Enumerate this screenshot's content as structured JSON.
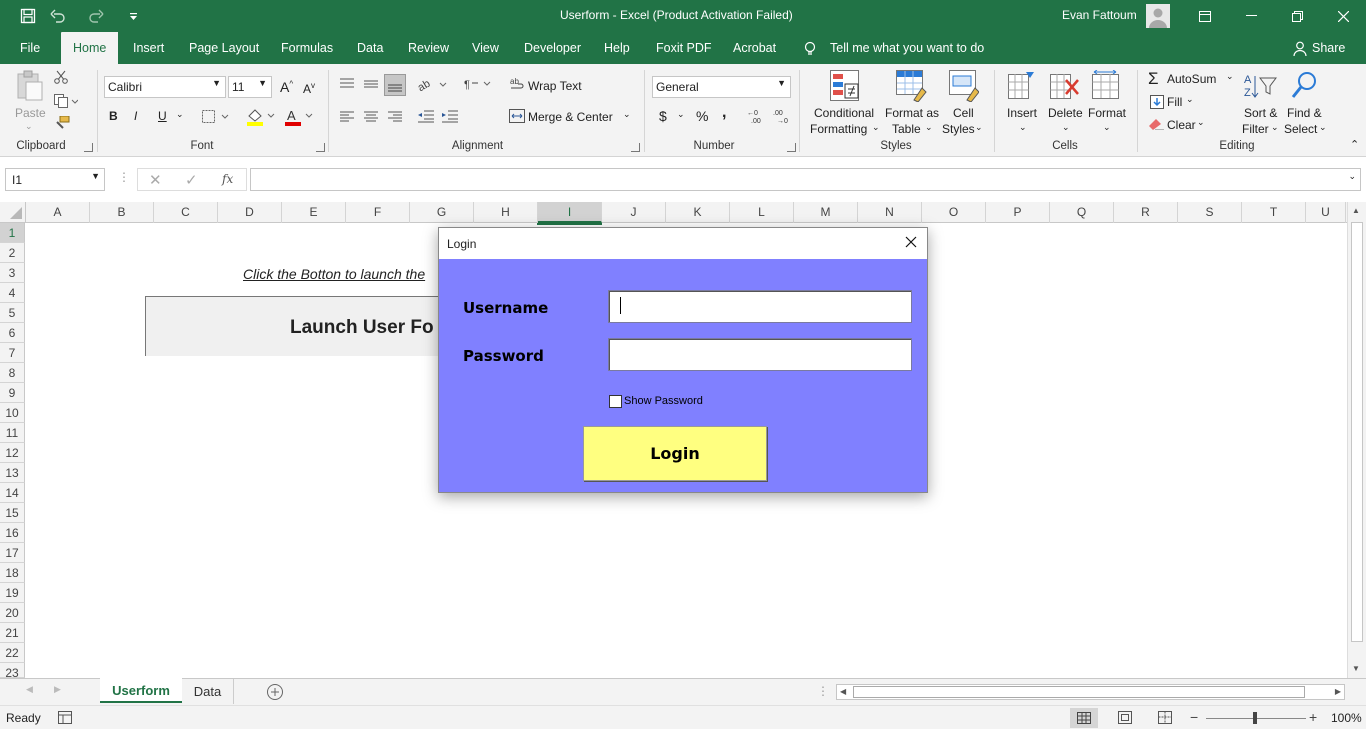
{
  "window": {
    "title": "Userform  -  Excel (Product Activation Failed)",
    "user": "Evan Fattoum"
  },
  "tabs": [
    "File",
    "Home",
    "Insert",
    "Page Layout",
    "Formulas",
    "Data",
    "Review",
    "View",
    "Developer",
    "Help",
    "Foxit PDF",
    "Acrobat"
  ],
  "tell_me": "Tell me what you want to do",
  "share": "Share",
  "ribbon": {
    "clipboard": {
      "label": "Clipboard",
      "paste": "Paste"
    },
    "font": {
      "label": "Font",
      "name": "Calibri",
      "size": "11",
      "bold": "B",
      "italic": "I",
      "underline": "U"
    },
    "alignment": {
      "label": "Alignment",
      "wrap": "Wrap Text",
      "merge": "Merge & Center"
    },
    "number": {
      "label": "Number",
      "format": "General",
      "currency": "$",
      "percent": "%",
      "comma": ","
    },
    "styles": {
      "label": "Styles",
      "conditional_1": "Conditional",
      "conditional_2": "Formatting",
      "table_1": "Format as",
      "table_2": "Table",
      "cell_1": "Cell",
      "cell_2": "Styles"
    },
    "cells": {
      "label": "Cells",
      "insert": "Insert",
      "delete": "Delete",
      "format": "Format"
    },
    "editing": {
      "label": "Editing",
      "autosum": "AutoSum",
      "fill": "Fill",
      "clear": "Clear",
      "sort_1": "Sort &",
      "sort_2": "Filter",
      "find_1": "Find &",
      "find_2": "Select"
    }
  },
  "formula_bar": {
    "name_box": "I1",
    "fx": "fx",
    "value": ""
  },
  "columns": [
    "A",
    "B",
    "C",
    "D",
    "E",
    "F",
    "G",
    "H",
    "I",
    "J",
    "K",
    "L",
    "M",
    "N",
    "O",
    "P",
    "Q",
    "R",
    "S",
    "T",
    "U"
  ],
  "rows": [
    "1",
    "2",
    "3",
    "4",
    "5",
    "6",
    "7",
    "8",
    "9",
    "10",
    "11",
    "12",
    "13",
    "14",
    "15",
    "16",
    "17",
    "18",
    "19",
    "20",
    "21",
    "22",
    "23"
  ],
  "sheet": {
    "instruction": "Click the Botton to launch the",
    "launch_button": "Launch User Fo"
  },
  "dialog": {
    "title": "Login",
    "username_label": "Username",
    "password_label": "Password",
    "username_value": "",
    "password_value": "",
    "show_password": "Show Password",
    "login_button": "Login"
  },
  "sheet_tabs": [
    "Userform",
    "Data"
  ],
  "status": {
    "ready": "Ready",
    "zoom": "100%"
  },
  "colors": {
    "excel_green": "#217346",
    "dialog_bg": "#8080ff",
    "login_button_bg": "#ffff80"
  }
}
